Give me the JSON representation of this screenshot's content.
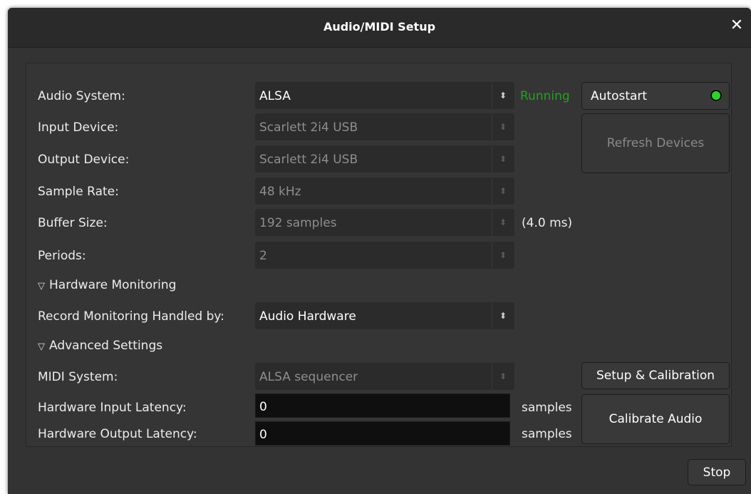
{
  "window": {
    "title": "Audio/MIDI Setup",
    "close_icon": "✕"
  },
  "audio_system": {
    "label": "Audio System:",
    "value": "ALSA",
    "status": "Running",
    "status_color": "#1fa31f"
  },
  "autostart": {
    "label": "Autostart",
    "led_color": "#2ed32e"
  },
  "refresh": {
    "label": "Refresh Devices"
  },
  "input_device": {
    "label": "Input Device:",
    "value": "Scarlett 2i4 USB"
  },
  "output_device": {
    "label": "Output Device:",
    "value": "Scarlett 2i4 USB"
  },
  "sample_rate": {
    "label": "Sample Rate:",
    "value": "48 kHz"
  },
  "buffer_size": {
    "label": "Buffer Size:",
    "value": "192 samples",
    "ms": "(4.0 ms)"
  },
  "periods": {
    "label": "Periods:",
    "value": "2"
  },
  "hardware_monitoring": {
    "label": "Hardware Monitoring"
  },
  "record_monitoring": {
    "label": "Record Monitoring Handled by:",
    "value": "Audio Hardware"
  },
  "advanced": {
    "label": "Advanced Settings"
  },
  "midi_system": {
    "label": "MIDI System:",
    "value": "ALSA sequencer"
  },
  "setup_calibration": {
    "label": "Setup & Calibration"
  },
  "input_latency": {
    "label": "Hardware Input Latency:",
    "value": "0",
    "unit": "samples"
  },
  "output_latency": {
    "label": "Hardware Output Latency:",
    "value": "0",
    "unit": "samples"
  },
  "calibrate": {
    "label": "Calibrate Audio"
  },
  "stop": {
    "label": "Stop"
  }
}
